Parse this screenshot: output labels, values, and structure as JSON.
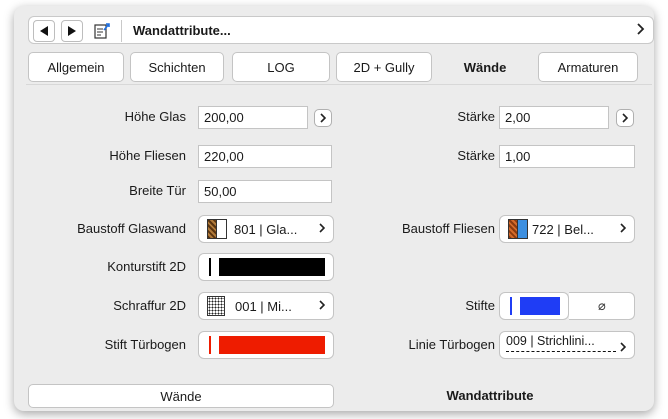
{
  "navbar": {
    "back_icon": "triangle-left-icon",
    "forward_icon": "triangle-right-icon",
    "document_icon": "document-arrow-icon",
    "title": "Wandattribute...",
    "chevron_icon": "chevron-right-icon"
  },
  "tabs": [
    {
      "label": "Allgemein",
      "active": false
    },
    {
      "label": "Schichten",
      "active": false
    },
    {
      "label": "LOG",
      "active": false
    },
    {
      "label": "2D + Gully",
      "active": false
    },
    {
      "label": "Wände",
      "active": true
    },
    {
      "label": "Armaturen",
      "active": false
    }
  ],
  "form": {
    "hoehe_glas": {
      "label": "Höhe Glas",
      "value": "200,00"
    },
    "staerke_1": {
      "label": "Stärke",
      "value": "2,00"
    },
    "hoehe_fliesen": {
      "label": "Höhe Fliesen",
      "value": "220,00"
    },
    "staerke_2": {
      "label": "Stärke",
      "value": "1,00"
    },
    "breite_tuer": {
      "label": "Breite Tür",
      "value": "50,00"
    },
    "baustoff_glaswand": {
      "label": "Baustoff Glaswand",
      "value": "801 | Gla...",
      "swatch_colors": [
        "#7a4a1a",
        "#ffffff"
      ]
    },
    "baustoff_fliesen": {
      "label": "Baustoff Fliesen",
      "value": "722 | Bel...",
      "swatch_colors": [
        "#b5531c",
        "#3d8fe0"
      ]
    },
    "konturstift_2d": {
      "label": "Konturstift 2D",
      "pen_color": "#000000"
    },
    "schraffur_2d": {
      "label": "Schraffur 2D",
      "value": "001 | Mi..."
    },
    "stifte": {
      "label": "Stifte",
      "pen_color": "#1f3df5",
      "empty_symbol": "⌀"
    },
    "stift_tuerbogen": {
      "label": "Stift Türbogen",
      "pen_color": "#ee1c00"
    },
    "linie_tuerbogen": {
      "label": "Linie Türbogen",
      "value": "009 | Strichlini..."
    }
  },
  "bottom": {
    "left_label": "Wände",
    "right_label": "Wandattribute"
  }
}
